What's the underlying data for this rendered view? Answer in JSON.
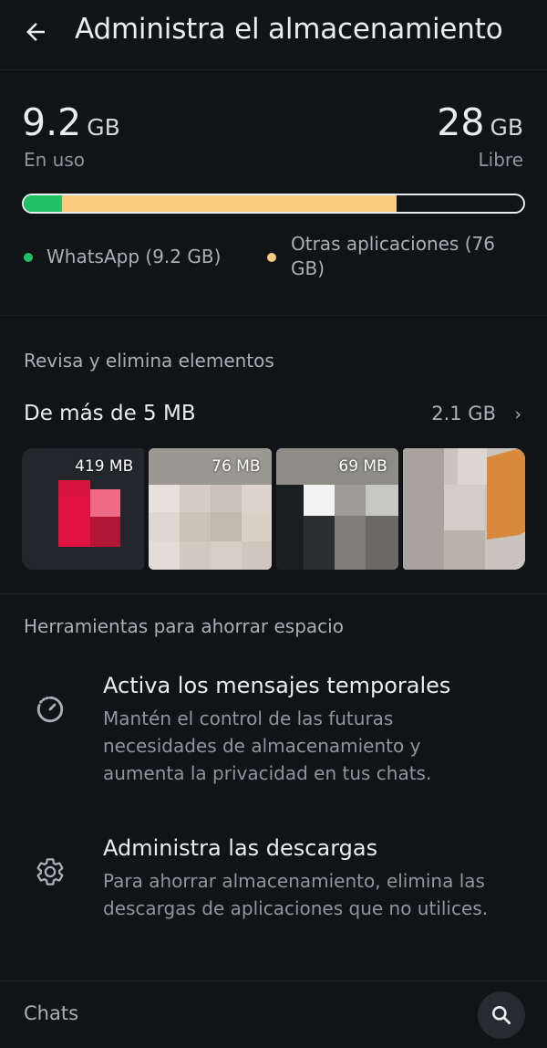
{
  "header": {
    "title": "Administra el almacenamiento",
    "back_icon": "arrow-back-icon"
  },
  "storage": {
    "used_value": "9.2",
    "used_unit": "GB",
    "used_label": "En uso",
    "free_value": "28",
    "free_unit": "GB",
    "free_label": "Libre",
    "bar_whatsapp_fraction": 0.077,
    "bar_other_fraction": 0.67,
    "colors": {
      "whatsapp": "#21c063",
      "other": "#fbcc7d"
    },
    "legend": [
      {
        "label": "WhatsApp (9.2 GB)"
      },
      {
        "label": "Otras aplicaciones (76 GB)"
      }
    ]
  },
  "review": {
    "heading": "Revisa y elimina elementos",
    "large_files": {
      "label": "De más de 5 MB",
      "value": "2.1 GB",
      "chevron": "chevron-right-icon"
    },
    "thumbnails": [
      {
        "size": "419 MB"
      },
      {
        "size": "76 MB"
      },
      {
        "size": "69 MB"
      },
      {
        "size": ""
      }
    ]
  },
  "tools": {
    "heading": "Herramientas para ahorrar espacio",
    "items": [
      {
        "icon": "timer-icon",
        "title": "Activa los mensajes temporales",
        "description": "Mantén el control de las futuras necesidades de almacenamiento y aumenta la privacidad en tus chats."
      },
      {
        "icon": "gear-icon",
        "title": "Administra las descargas",
        "description": "Para ahorrar almacenamiento, elimina las descargas de aplicaciones que no utilices."
      }
    ]
  },
  "chats": {
    "label": "Chats",
    "search_icon": "search-icon"
  }
}
